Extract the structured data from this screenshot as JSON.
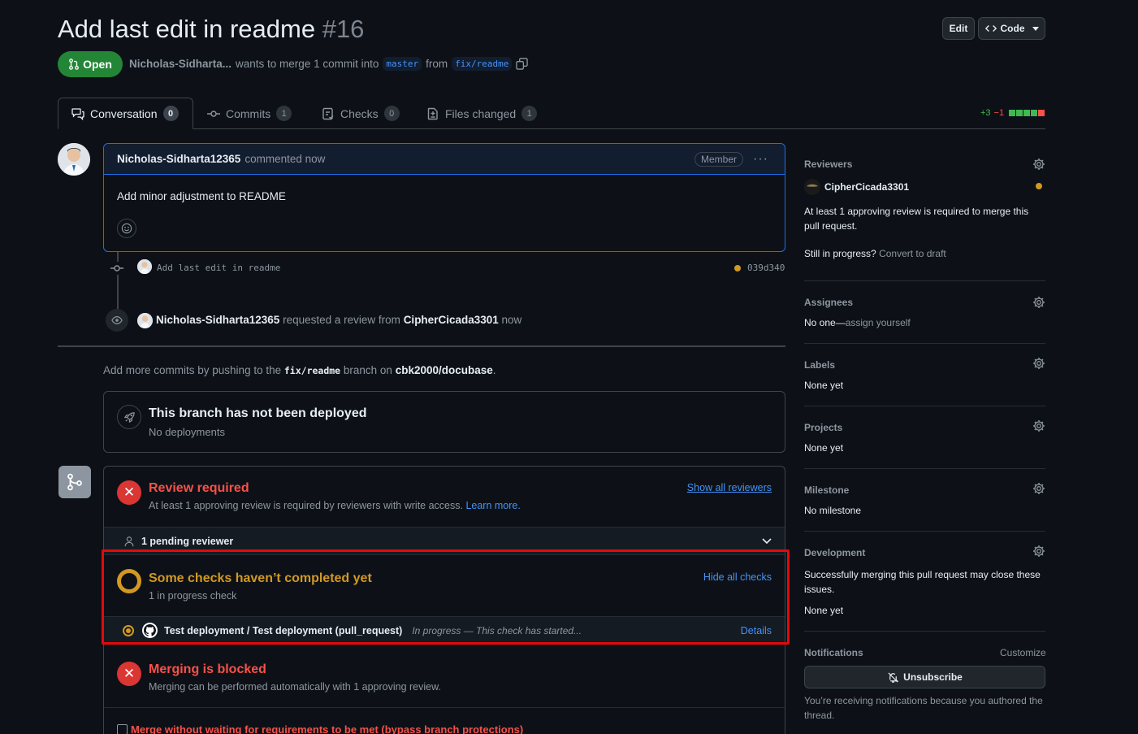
{
  "header": {
    "title": "Add last edit in readme",
    "number": "#16",
    "edit_label": "Edit",
    "code_label": "Code",
    "state_label": "Open",
    "author": "Nicholas-Sidharta...",
    "merge_text": "wants to merge 1 commit into",
    "base_branch": "master",
    "from_text": "from",
    "head_branch": "fix/readme"
  },
  "tabs": [
    {
      "label": "Conversation",
      "count": "0"
    },
    {
      "label": "Commits",
      "count": "1"
    },
    {
      "label": "Checks",
      "count": "0"
    },
    {
      "label": "Files changed",
      "count": "1"
    }
  ],
  "diffstat": {
    "additions": "+3",
    "deletions": "−1",
    "colors": [
      "#3fb950",
      "#3fb950",
      "#3fb950",
      "#3fb950",
      "#f85149"
    ]
  },
  "comment": {
    "author": "Nicholas-Sidharta12365",
    "action": "commented now",
    "badge": "Member",
    "body": "Add minor adjustment to README"
  },
  "commit": {
    "message": "Add last edit in readme",
    "sha": "039d340"
  },
  "review_request": {
    "actor": "Nicholas-Sidharta12365",
    "text": "requested a review from",
    "reviewer": "CipherCicada3301",
    "time": "now"
  },
  "push_hint": {
    "pre": "Add more commits by pushing to the",
    "branch": "fix/readme",
    "mid": "branch on",
    "repo": "cbk2000/docubase",
    "post": "."
  },
  "deploy": {
    "title": "This branch has not been deployed",
    "subtitle": "No deployments"
  },
  "merge_box": {
    "review": {
      "title": "Review required",
      "desc": "At least 1 approving review is required by reviewers with write access.",
      "learn_more": "Learn more.",
      "show_all": "Show all reviewers",
      "pending": "1 pending reviewer"
    },
    "checks": {
      "title": "Some checks haven’t completed yet",
      "subtitle": "1 in progress check",
      "hide_all": "Hide all checks",
      "row_name": "Test deployment / Test deployment (pull_request)",
      "row_status": "In progress — This check has started...",
      "details": "Details"
    },
    "blocked": {
      "title": "Merging is blocked",
      "desc": "Merging can be performed automatically with 1 approving review."
    },
    "bypass_label": "Merge without waiting for requirements to be met (bypass branch protections)"
  },
  "sidebar": {
    "reviewers": {
      "label": "Reviewers",
      "name": "CipherCicada3301",
      "note": "At least 1 approving review is required to merge this pull request.",
      "draft_q": "Still in progress?",
      "draft_link": "Convert to draft"
    },
    "assignees": {
      "label": "Assignees",
      "value": "No one—",
      "link": "assign yourself"
    },
    "labels": {
      "label": "Labels",
      "value": "None yet"
    },
    "projects": {
      "label": "Projects",
      "value": "None yet"
    },
    "milestone": {
      "label": "Milestone",
      "value": "No milestone"
    },
    "development": {
      "label": "Development",
      "note": "Successfully merging this pull request may close these issues.",
      "value": "None yet"
    },
    "notifications": {
      "label": "Notifications",
      "customize": "Customize",
      "button": "Unsubscribe",
      "note": "You’re receiving notifications because you authored the thread."
    }
  },
  "colors": {
    "highlight_border": "#e5090b",
    "pending": "#d29922",
    "danger": "#f85149",
    "accent": "#4493f8"
  }
}
